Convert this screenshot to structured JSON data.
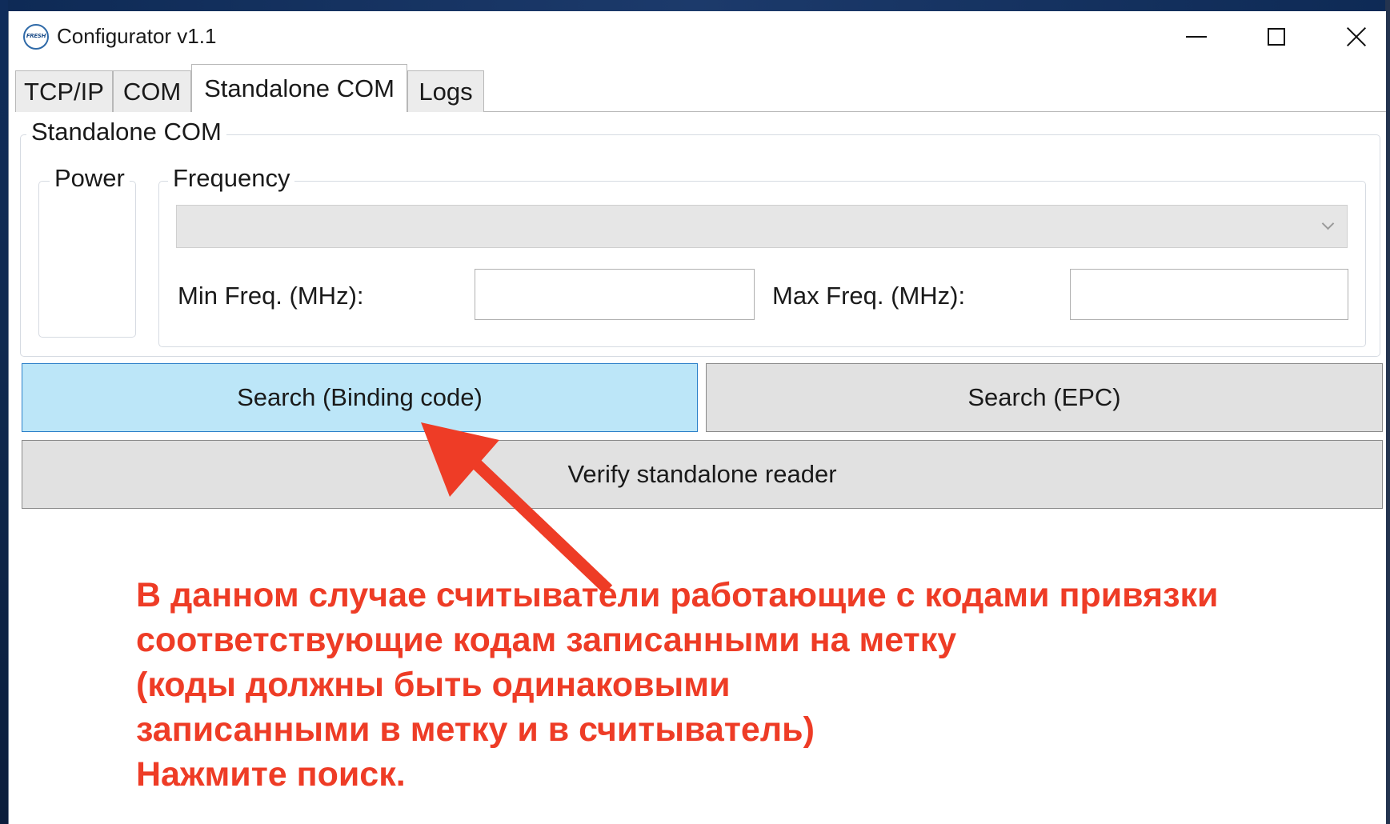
{
  "window": {
    "title": "Configurator v1.1",
    "app_icon_text": "FRESH"
  },
  "tabs": [
    {
      "label": "TCP/IP",
      "active": false
    },
    {
      "label": "COM",
      "active": false
    },
    {
      "label": "Standalone COM",
      "active": true
    },
    {
      "label": "Logs",
      "active": false
    }
  ],
  "standalone": {
    "group_title": "Standalone COM",
    "power_group_title": "Power",
    "frequency_group_title": "Frequency",
    "frequency_select_value": "",
    "min_freq_label": "Min Freq. (MHz):",
    "min_freq_value": "",
    "max_freq_label": "Max Freq. (MHz):",
    "max_freq_value": ""
  },
  "buttons": {
    "search_binding": "Search (Binding code)",
    "search_epc": "Search (EPC)",
    "verify": "Verify standalone reader"
  },
  "annotation": {
    "color": "#ee3c26",
    "lines": [
      "В данном случае считыватели работающие с кодами привязки",
      "соответствующие кодам записанными на метку",
      "(коды должны быть одинаковыми",
      "записанными в метку и в считыватель)",
      "Нажмите поиск."
    ]
  },
  "colors": {
    "hover_button": "#bce6f8",
    "hover_border": "#2b7fc9",
    "annotation_red": "#ee3c26"
  }
}
